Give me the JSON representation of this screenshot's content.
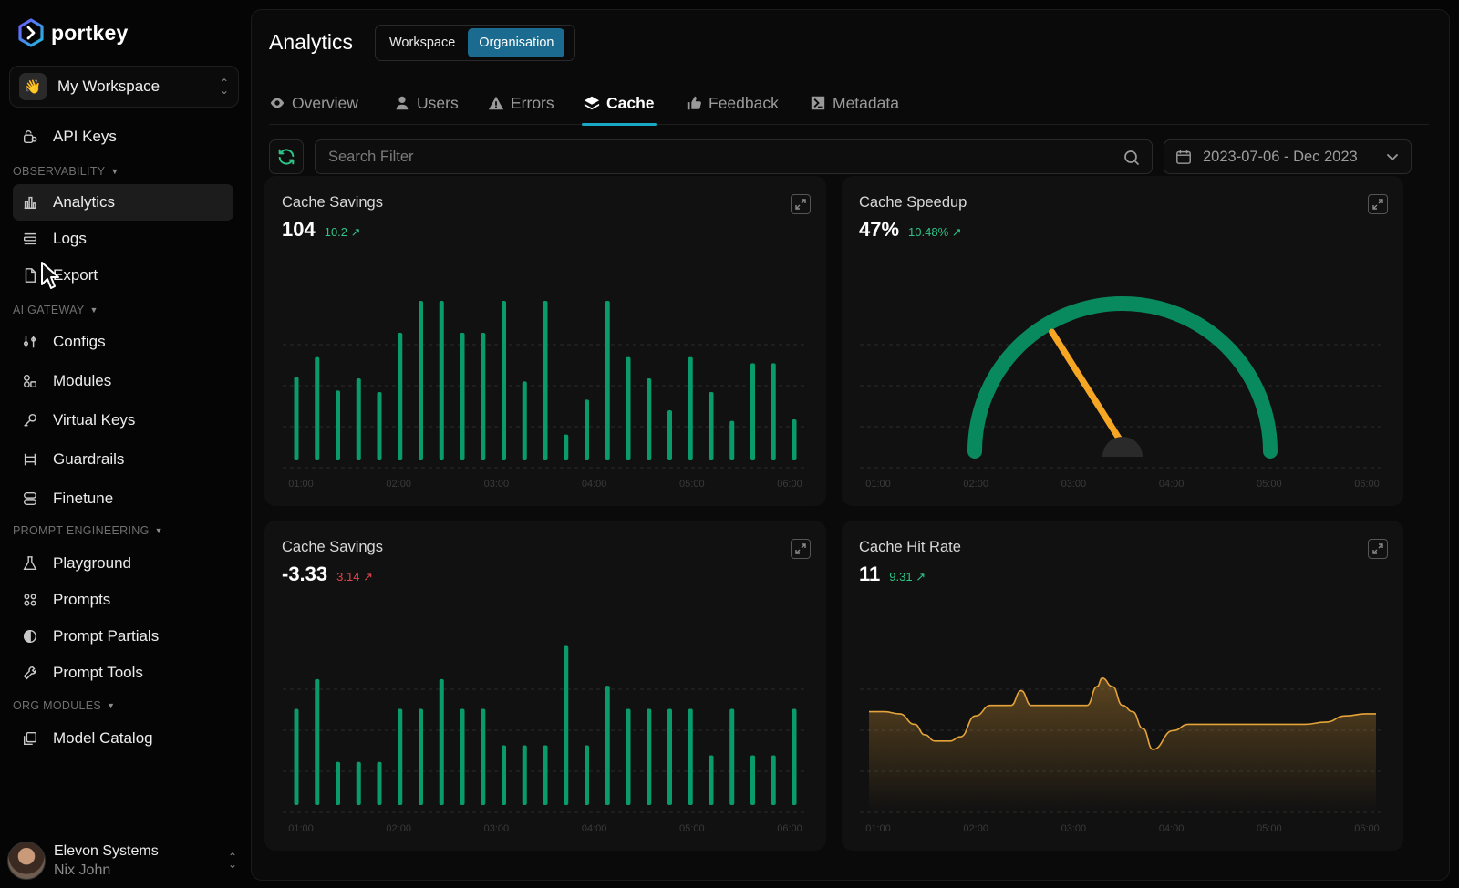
{
  "brand": {
    "name": "portkey"
  },
  "workspace": {
    "name": "My Workspace",
    "emoji": "👋"
  },
  "sidebar": {
    "api_keys": "API Keys",
    "sections": {
      "observability": "OBSERVABILITY",
      "ai_gateway": "AI GATEWAY",
      "prompt_engineering": "PROMPT ENGINEERING",
      "org_modules": "ORG MODULES"
    },
    "observability_items": [
      "Analytics",
      "Logs",
      "Export"
    ],
    "gateway_items": [
      "Configs",
      "Modules",
      "Virtual Keys",
      "Guardrails",
      "Finetune"
    ],
    "prompt_items": [
      "Playground",
      "Prompts",
      "Prompt Partials",
      "Prompt Tools"
    ],
    "org_items": [
      "Model Catalog"
    ],
    "active_item": "Analytics"
  },
  "user": {
    "org": "Elevon Systems",
    "name": "Nix John"
  },
  "header": {
    "title": "Analytics",
    "scope_options": [
      "Workspace",
      "Organisation"
    ],
    "scope_selected": "Organisation"
  },
  "tabs": [
    "Overview",
    "Users",
    "Errors",
    "Cache",
    "Feedback",
    "Metadata"
  ],
  "active_tab": "Cache",
  "filter": {
    "search_placeholder": "Search Filter",
    "date_range": "2023-07-06 - Dec 2023"
  },
  "colors": {
    "accent": "#18a7c4",
    "bar_green": "#0a9b6c",
    "gauge_green": "#098a5e",
    "needle": "#f5a623",
    "line_orange": "#e5a43a",
    "positive": "#2ec487",
    "negative": "#e0444b"
  },
  "chart_data": [
    {
      "type": "bar",
      "title": "Cache Savings",
      "value": "104",
      "delta": "10.2",
      "x_ticks": [
        "01:00",
        "02:00",
        "03:00",
        "04:00",
        "05:00",
        "06:00"
      ],
      "values": [
        55,
        68,
        46,
        54,
        45,
        84,
        105,
        105,
        84,
        84,
        105,
        52,
        105,
        17,
        40,
        105,
        68,
        54,
        33,
        68,
        45,
        26,
        64,
        64,
        27
      ],
      "ylim": [
        0,
        120
      ]
    },
    {
      "type": "gauge",
      "title": "Cache Speedup",
      "value": "47%",
      "delta": "10.48%",
      "percent": 33,
      "x_ticks": [
        "01:00",
        "02:00",
        "03:00",
        "04:00",
        "05:00",
        "06:00"
      ]
    },
    {
      "type": "bar",
      "title": "Cache Savings",
      "value": "-3.33",
      "delta": "3.14",
      "x_ticks": [
        "01:00",
        "02:00",
        "03:00",
        "04:00",
        "05:00",
        "06:00"
      ],
      "values": [
        58,
        76,
        26,
        26,
        26,
        58,
        58,
        76,
        58,
        58,
        36,
        36,
        36,
        96,
        36,
        72,
        58,
        58,
        58,
        58,
        30,
        58,
        30,
        30,
        58
      ],
      "ylim": [
        0,
        110
      ]
    },
    {
      "type": "area",
      "title": "Cache Hit Rate",
      "value": "11",
      "delta": "9.31",
      "x_ticks": [
        "01:00",
        "02:00",
        "03:00",
        "04:00",
        "05:00",
        "06:00"
      ],
      "x": [
        0,
        3,
        6,
        9,
        11,
        13,
        14,
        16,
        18,
        21,
        24,
        26,
        28,
        30,
        32,
        34,
        36,
        40,
        43,
        45,
        46,
        48,
        50,
        52,
        54,
        56,
        60,
        63,
        66,
        70,
        74,
        80,
        86,
        90,
        94,
        98,
        100
      ],
      "values": [
        48,
        48,
        47,
        42,
        37,
        34,
        34,
        34,
        36,
        46,
        51,
        51,
        51,
        58,
        51,
        51,
        51,
        51,
        51,
        60,
        64,
        60,
        51,
        48,
        40,
        30,
        39,
        42,
        42,
        42,
        42,
        42,
        42,
        43,
        46,
        47,
        47
      ],
      "ylim": [
        0,
        100
      ]
    }
  ]
}
